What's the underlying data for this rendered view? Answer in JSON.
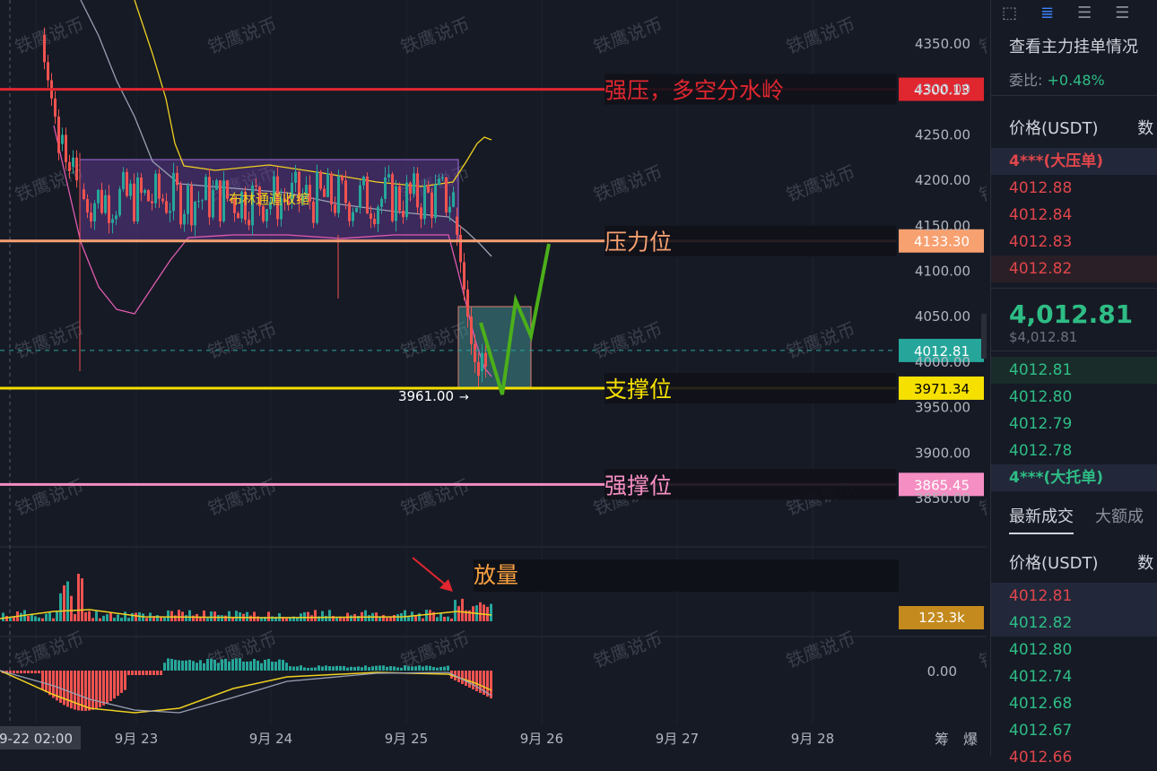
{
  "chart_data": {
    "type": "candlestick",
    "symbol_quote": "USDT",
    "y_ticks": [
      "4350.00",
      "4300.00",
      "4250.00",
      "4200.00",
      "4150.00",
      "4100.00",
      "4050.00",
      "4000.00",
      "3950.00",
      "3900.00",
      "3850.00"
    ],
    "y_range": [
      3828,
      4360
    ],
    "x_ticks": [
      "9-22 02:00",
      "9月 23",
      "9月 24",
      "9月 25",
      "9月 26",
      "9月 27",
      "9月 28"
    ],
    "levels": [
      {
        "price": 4300.13,
        "label": "4300.13",
        "note": "强压，多空分水岭",
        "color": "#e0262f"
      },
      {
        "price": 4133.3,
        "label": "4133.30",
        "note": "压力位",
        "color": "#f7a070"
      },
      {
        "price": 4012.81,
        "label": "4012.81",
        "note": "",
        "color": "#26a69a"
      },
      {
        "price": 3971.34,
        "label": "3971.34",
        "note": "支撑位",
        "color": "#f5e000"
      },
      {
        "price": 3865.45,
        "label": "3865.45",
        "note": "强撑位",
        "color": "#f58ec2"
      }
    ],
    "annotations": {
      "bollinger_box": "布林通道收缩",
      "low_marker": "3961.00",
      "volume_note": "放量"
    },
    "volume_last": "123.3k",
    "macd_zero": "0.00",
    "bottom_right": [
      "筹",
      "爆"
    ],
    "watermark": "铁鹰说币",
    "colors": {
      "up": "#26a69a",
      "down": "#ef5350",
      "bg": "#161a25"
    }
  },
  "orderbook": {
    "title": "查看主力挂单情况",
    "ratio_label": "委比:",
    "ratio_value": "+0.48%",
    "price_header": "价格(USDT)",
    "price_header_cut": "数",
    "big_ask": "4***(大压单)",
    "asks": [
      "4012.88",
      "4012.84",
      "4012.83",
      "4012.82"
    ],
    "last_price": "4,012.81",
    "last_usd": "$4,012.81",
    "bids": [
      "4012.81",
      "4012.80",
      "4012.79",
      "4012.78"
    ],
    "big_bid": "4***(大托单)",
    "trade_tabs": [
      "最新成交",
      "大额成"
    ],
    "trades_header": "价格(USDT)",
    "trades_header_cut": "数",
    "trades": [
      {
        "p": "4012.81",
        "side": "sell"
      },
      {
        "p": "4012.82",
        "side": "buy"
      },
      {
        "p": "4012.80",
        "side": "buy"
      },
      {
        "p": "4012.74",
        "side": "buy"
      },
      {
        "p": "4012.68",
        "side": "buy"
      },
      {
        "p": "4012.67",
        "side": "buy"
      },
      {
        "p": "4012.66",
        "side": "sell"
      }
    ]
  }
}
